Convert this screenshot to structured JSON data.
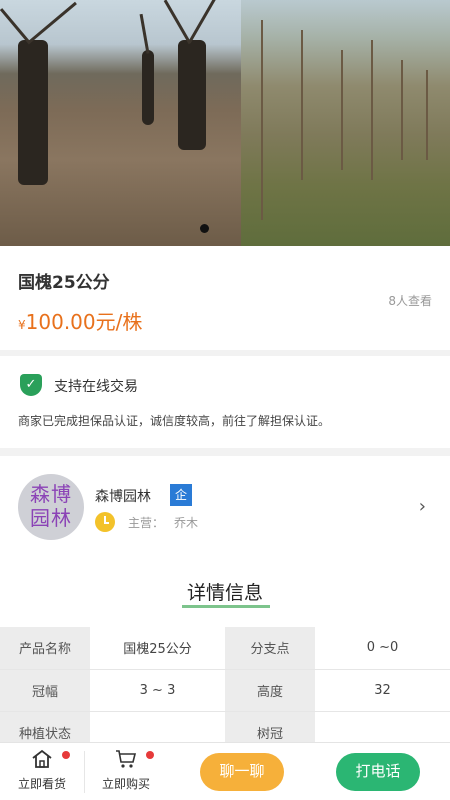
{
  "product": {
    "title": "国槐25公分",
    "views": "8人查看",
    "price_symbol": "¥",
    "price": "100.00元/株"
  },
  "guarantee": {
    "icon": "shield-check-icon",
    "title": "支持在线交易",
    "description": "商家已完成担保品认证，诚信度较高，前往了解担保认证。"
  },
  "seller": {
    "avatar_text": "森博园林",
    "name": "森博园林",
    "badge": "企",
    "main_business_label": "主营：",
    "main_business": "乔木"
  },
  "details": {
    "title": "详情信息",
    "rows": [
      {
        "label1": "产品名称",
        "value1": "国槐25公分",
        "label2": "分支点",
        "value2": "0 ~0"
      },
      {
        "label1": "冠幅",
        "value1": "3 ~ 3",
        "label2": "高度",
        "value2": "32"
      },
      {
        "label1": "种植状态",
        "value1": "",
        "label2": "树冠",
        "value2": ""
      }
    ]
  },
  "bottom_bar": {
    "tab_see": "立即看货",
    "tab_buy": "立即购买",
    "chat": "聊一聊",
    "call": "打电话"
  },
  "colors": {
    "price": "#e8711c",
    "chat_button": "#f6b03a",
    "call_button": "#2bb673",
    "underline": "#7dc48c",
    "badge": "#2a7bd6"
  }
}
